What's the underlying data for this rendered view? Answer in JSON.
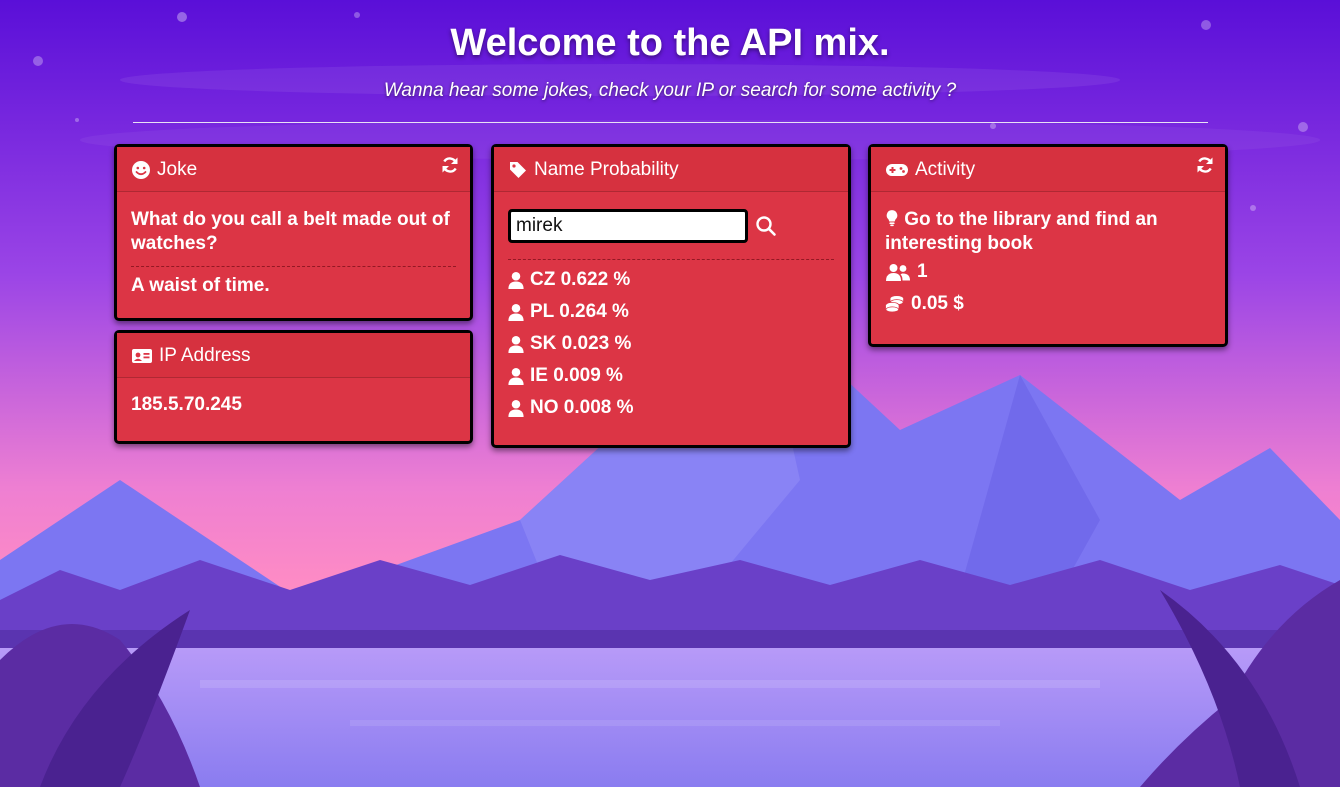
{
  "header": {
    "title": "Welcome to the API mix.",
    "subtitle": "Wanna hear some jokes, check your IP or search for some activity ?"
  },
  "joke": {
    "title": "Joke",
    "icon": "smile-icon",
    "setup": "What do you call a belt made out of watches?",
    "punchline": "A waist of time.",
    "refresh_icon": "refresh-icon"
  },
  "ip": {
    "title": "IP Address",
    "icon": "id-card-icon",
    "value": "185.5.70.245"
  },
  "name": {
    "title": "Name Probability",
    "icon": "tag-icon",
    "input_value": "mirek",
    "search_icon": "search-icon",
    "results": [
      {
        "text": "CZ 0.622 %"
      },
      {
        "text": "PL 0.264 %"
      },
      {
        "text": "SK 0.023 %"
      },
      {
        "text": "IE 0.009 %"
      },
      {
        "text": "NO 0.008 %"
      }
    ]
  },
  "activity": {
    "title": "Activity",
    "icon": "gamepad-icon",
    "description": "Go to the library and find an interesting book",
    "participants": "1",
    "price": "0.05 $",
    "refresh_icon": "refresh-icon"
  },
  "colors": {
    "card": "#dc3545",
    "sky_top": "#5a0fd8",
    "sky_mid": "#a24be6",
    "sky_horizon": "#ff88c8",
    "mountain": "#7a73f0",
    "forest": "#6a3fc7",
    "water": "#a58cf5"
  }
}
